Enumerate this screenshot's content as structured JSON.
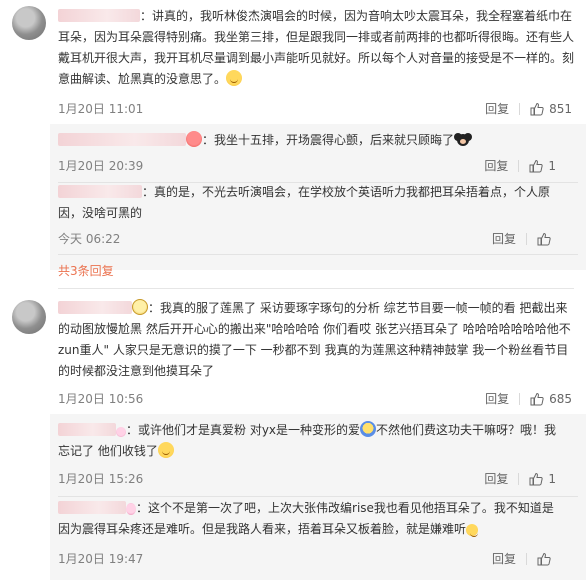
{
  "icons": {
    "like": "thumbs-up-icon"
  },
  "colors": {
    "link": "#eb7350",
    "meta": "#808080",
    "sub_bg": "#f5f5f5"
  },
  "comments": [
    {
      "body": "：讲真的，我听林俊杰演唱会的时候，因为音响太吵太震耳朵，我全程塞着纸巾在耳朵，因为耳朵震得特别痛。我坐第三排，但是跟我同一排或者前两排的也都听得很晦。还有些人戴耳机开很大声，我开耳机尽量调到最小声能听见就好。所以每个人对音量的接受是不一样的。刻意曲解读、尬黑真的没意思了。",
      "time": "1月20日 11:01",
      "reply": "回复",
      "likes": "851",
      "replies": [
        {
          "body": "我坐十五排，开场震得心颤，后来就只顾晦了",
          "time": "1月20日 20:39",
          "reply": "回复",
          "likes": "1"
        },
        {
          "body": "：真的是，不光去听演唱会，在学校放个英语听力我都把耳朵捂着点，个人原因，没啥可黑的",
          "time": "今天 06:22",
          "reply": "回复",
          "likes": ""
        }
      ],
      "more": "共3条回复"
    },
    {
      "body": "我真的服了莲黑了 采访要琢字琢句的分析 综艺节目要一帧一帧的看 把截出来的动图放慢尬黑 然后开开心心的搬出来\"哈哈哈哈 你们看哎 张艺兴捂耳朵了 哈哈哈哈哈哈哈他不zun重人\" 人家只是无意识的摸了一下 一秒都不到 我真的为莲黑这种精神鼓掌 我一个粉丝看节目的时候都没注意到他摸耳朵了",
      "time": "1月20日 10:56",
      "reply": "回复",
      "likes": "685",
      "replies": [
        {
          "body": "：或许他们才是真爱粉 对yx是一种变形的爱",
          "body2": "不然他们费这功夫干嘛呀？哦！我忘记了 他们收钱了",
          "time": "1月20日 15:26",
          "reply": "回复",
          "likes": "1"
        },
        {
          "body": "这个不是第一次了吧，上次大张伟改编rise我也看见他捂耳朵了。我不知道是因为震得耳朵疼还是难听。但是我路人看来，捂着耳朵又板着脸，就是嫌难听",
          "time": "1月20日 19:47",
          "reply": "回复",
          "likes": ""
        }
      ]
    }
  ]
}
